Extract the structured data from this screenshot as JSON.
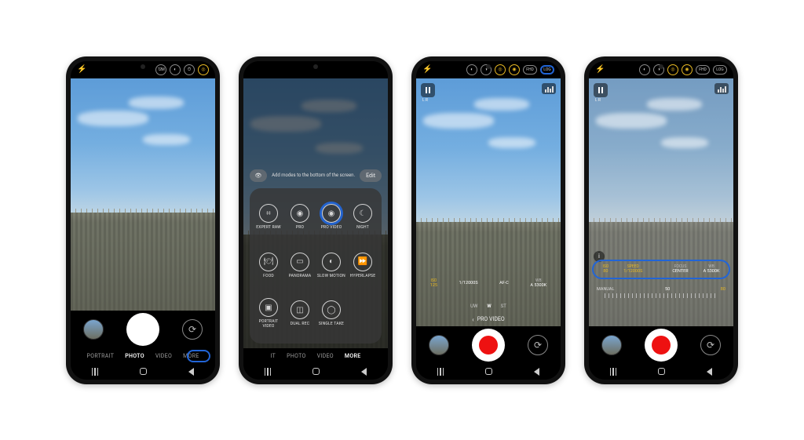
{
  "top_icons": {
    "flash": "⚡",
    "mp": "12M",
    "ratio": "◐",
    "timer": "⏱",
    "motion_gold": "◎"
  },
  "phone1": {
    "modes": [
      "PORTRAIT",
      "PHOTO",
      "VIDEO",
      "MORE"
    ],
    "active_mode": "PHOTO",
    "highlight_mode": "MORE"
  },
  "phone2": {
    "hint": "Add modes to the bottom of the screen.",
    "edit": "Edit",
    "grid": [
      {
        "label": "EXPERT RAW",
        "glyph": "⌗"
      },
      {
        "label": "PRO",
        "glyph": "◉"
      },
      {
        "label": "PRO VIDEO",
        "glyph": "◉",
        "highlight": true
      },
      {
        "label": "NIGHT",
        "glyph": "☾"
      },
      {
        "label": "FOOD",
        "glyph": "🍽"
      },
      {
        "label": "PANORAMA",
        "glyph": "▭"
      },
      {
        "label": "SLOW MOTION",
        "glyph": "◐"
      },
      {
        "label": "HYPERLAPSE",
        "glyph": "⏩"
      },
      {
        "label": "PORTRAIT VIDEO",
        "glyph": "▣"
      },
      {
        "label": "DUAL REC",
        "glyph": "◫"
      },
      {
        "label": "SINGLE TAKE",
        "glyph": "◯"
      }
    ],
    "strip": [
      "IT",
      "PHOTO",
      "VIDEO",
      "MORE"
    ],
    "active_strip": "MORE"
  },
  "phone3": {
    "pause_sub": "L R",
    "params": [
      {
        "k": "ISO",
        "v": "125",
        "gold": true
      },
      {
        "k": "",
        "v": "1/12000S"
      },
      {
        "k": "AF-C",
        "v": ""
      },
      {
        "k": "WB",
        "v": "A 5300K"
      }
    ],
    "zoom": [
      "UW",
      "W",
      "ST"
    ],
    "zoom_active": "W",
    "mode_label": "PRO VIDEO"
  },
  "phone4": {
    "pause_sub": "L R",
    "params": [
      {
        "k": "ISO",
        "v": "80",
        "gold": true
      },
      {
        "k": "SPEED",
        "v": "1/12000S",
        "gold": true
      },
      {
        "k": "",
        "v": ""
      },
      {
        "k": "FOCUS",
        "v": "CENTER"
      },
      {
        "k": "WB",
        "v": "A 5300K"
      }
    ],
    "scale_left": "MANUAL",
    "scale_mid": "50",
    "scale_right": "80"
  }
}
